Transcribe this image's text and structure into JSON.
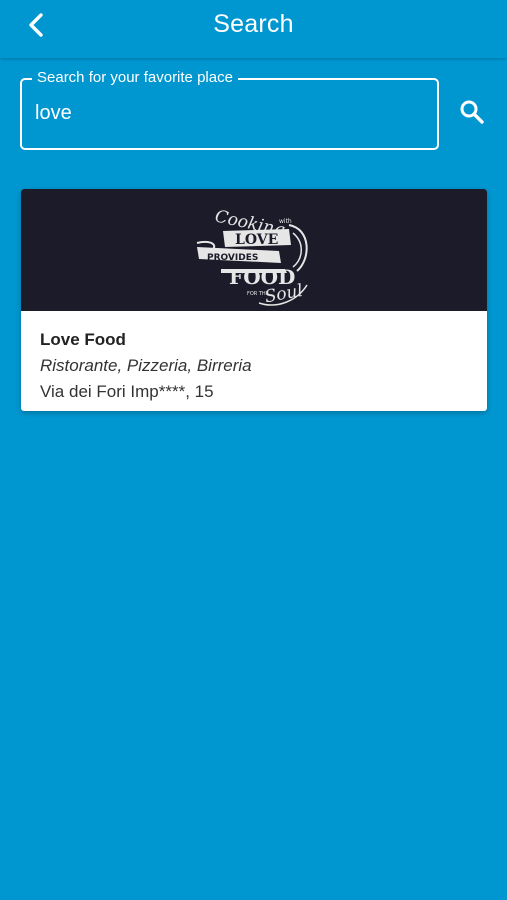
{
  "colors": {
    "background": "#0097d1",
    "card": "#ffffff",
    "card_image_bg": "#1b1b29",
    "text_on_primary": "#ffffff"
  },
  "header": {
    "title": "Search",
    "back_icon": "chevron-left-icon"
  },
  "search": {
    "legend": "Search for your favorite place",
    "value": "love",
    "button_icon": "search-icon"
  },
  "results": [
    {
      "name": "Love Food",
      "category": "Ristorante, Pizzeria, Birreria",
      "address": "Via dei Fori Imp****, 15",
      "logo_text": [
        "Cooking",
        "with",
        "LOVE",
        "PROVIDES",
        "FOOD",
        "FOR THE",
        "Soul"
      ]
    }
  ]
}
